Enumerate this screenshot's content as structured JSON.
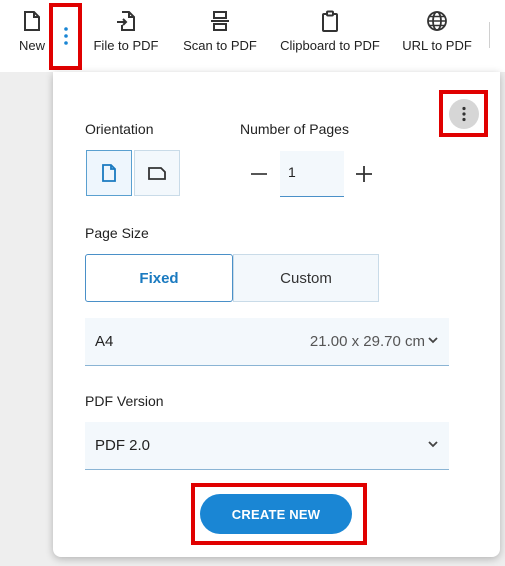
{
  "toolbar": {
    "items": [
      {
        "label": "New",
        "icon": "new-document-icon"
      },
      {
        "label": "File to PDF",
        "icon": "file-import-icon"
      },
      {
        "label": "Scan to PDF",
        "icon": "scanner-icon"
      },
      {
        "label": "Clipboard to PDF",
        "icon": "clipboard-icon"
      },
      {
        "label": "URL to PDF",
        "icon": "globe-icon"
      }
    ],
    "more_icon": "more-vertical-icon"
  },
  "panel": {
    "orientation_label": "Orientation",
    "orientation_options": [
      "portrait-icon",
      "landscape-icon"
    ],
    "orientation_selected": "portrait",
    "pages_label": "Number of Pages",
    "pages_value": "1",
    "page_size_label": "Page Size",
    "size_modes": [
      "Fixed",
      "Custom"
    ],
    "size_mode_selected": "Fixed",
    "size_select": {
      "name": "A4",
      "dimensions": "21.00 x 29.70 cm"
    },
    "pdf_version_label": "PDF Version",
    "pdf_version_value": "PDF 2.0",
    "create_button": "CREATE NEW"
  },
  "colors": {
    "accent": "#1a86d4",
    "highlight": "#e00000",
    "field_bg": "#f3f8fc"
  }
}
